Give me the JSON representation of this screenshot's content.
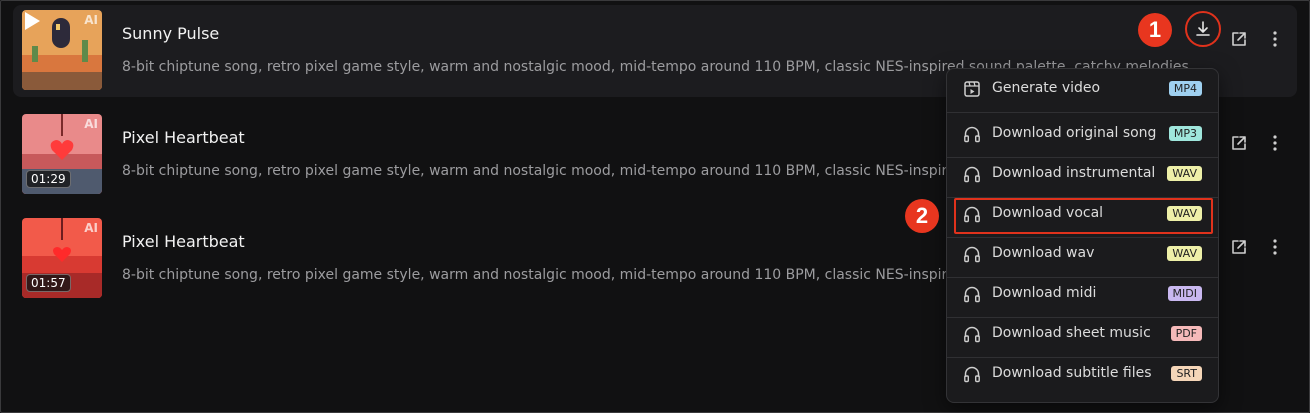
{
  "songs": [
    {
      "title": "Sunny Pulse",
      "description": "8-bit chiptune song, retro pixel game style, warm and nostalgic mood, mid-tempo around 110 BPM, classic NES-inspired sound palette, catchy melodies",
      "ai_label": "AI",
      "duration": "",
      "active": true,
      "palette": [
        "#e7a35a",
        "#d9773e",
        "#8a5a3a",
        "#2d2a3a"
      ]
    },
    {
      "title": "Pixel Heartbeat",
      "description": "8-bit chiptune song, retro pixel game style, warm and nostalgic mood, mid-tempo around 110 BPM, classic NES-inspired sound palette, catchy melodies",
      "ai_label": "AI",
      "duration": "01:29",
      "active": false,
      "palette": [
        "#e98a8a",
        "#c7595b",
        "#4f5a6e",
        "#3a3f4f"
      ]
    },
    {
      "title": "Pixel Heartbeat",
      "description": "8-bit chiptune song, retro pixel game style, warm and nostalgic mood, mid-tempo around 110 BPM, classic NES-inspired sound palette, catchy melodies",
      "ai_label": "AI",
      "duration": "01:57",
      "active": false,
      "palette": [
        "#f25a4a",
        "#d83a32",
        "#a82a28",
        "#6d1c1e"
      ]
    }
  ],
  "annotations": {
    "step1": "1",
    "step2": "2"
  },
  "menu": {
    "items": [
      {
        "label": "Generate video",
        "tag": "MP4",
        "tag_color": "#9fd0f0",
        "icon": "video-icon"
      },
      {
        "label": "Download original song",
        "tag": "MP3",
        "tag_color": "#9fe6dc",
        "icon": "headphones-icon"
      },
      {
        "label": "Download instrumental",
        "tag": "WAV",
        "tag_color": "#eef0a8",
        "icon": "headphones-icon"
      },
      {
        "label": "Download vocal",
        "tag": "WAV",
        "tag_color": "#eef0a8",
        "icon": "headphones-icon"
      },
      {
        "label": "Download wav",
        "tag": "WAV",
        "tag_color": "#eef0a8",
        "icon": "headphones-icon"
      },
      {
        "label": "Download midi",
        "tag": "MIDI",
        "tag_color": "#c9b8f0",
        "icon": "headphones-icon"
      },
      {
        "label": "Download sheet music",
        "tag": "PDF",
        "tag_color": "#f5b9b9",
        "icon": "headphones-icon"
      },
      {
        "label": "Download subtitle files",
        "tag": "SRT",
        "tag_color": "#f5d6b8",
        "icon": "headphones-icon"
      }
    ]
  },
  "colors": {
    "accent_red": "#e0321c"
  }
}
